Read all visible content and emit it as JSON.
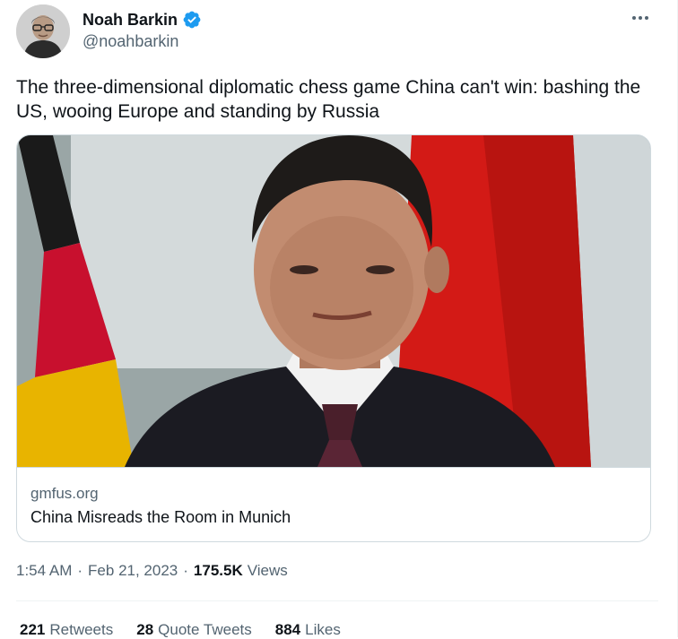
{
  "author": {
    "name": "Noah Barkin",
    "handle": "@noahbarkin",
    "verified": true,
    "avatar_icon": "profile-photo"
  },
  "tweet": {
    "text": "The three-dimensional diplomatic chess game China can't win: bashing the US, wooing Europe and standing by Russia"
  },
  "card": {
    "domain": "gmfus.org",
    "title": "China Misreads the Room in Munich",
    "image_icon": "article-photo"
  },
  "meta": {
    "time": "1:54 AM",
    "separator": "·",
    "date": "Feb 21, 2023",
    "views_count": "175.5K",
    "views_label": "Views"
  },
  "stats": {
    "retweets_count": "221",
    "retweets_label": "Retweets",
    "quotes_count": "28",
    "quotes_label": "Quote Tweets",
    "likes_count": "884",
    "likes_label": "Likes"
  },
  "colors": {
    "text_primary": "#0f1419",
    "text_secondary": "#536471",
    "verified_blue": "#1d9bf0",
    "border": "#cfd9de"
  }
}
